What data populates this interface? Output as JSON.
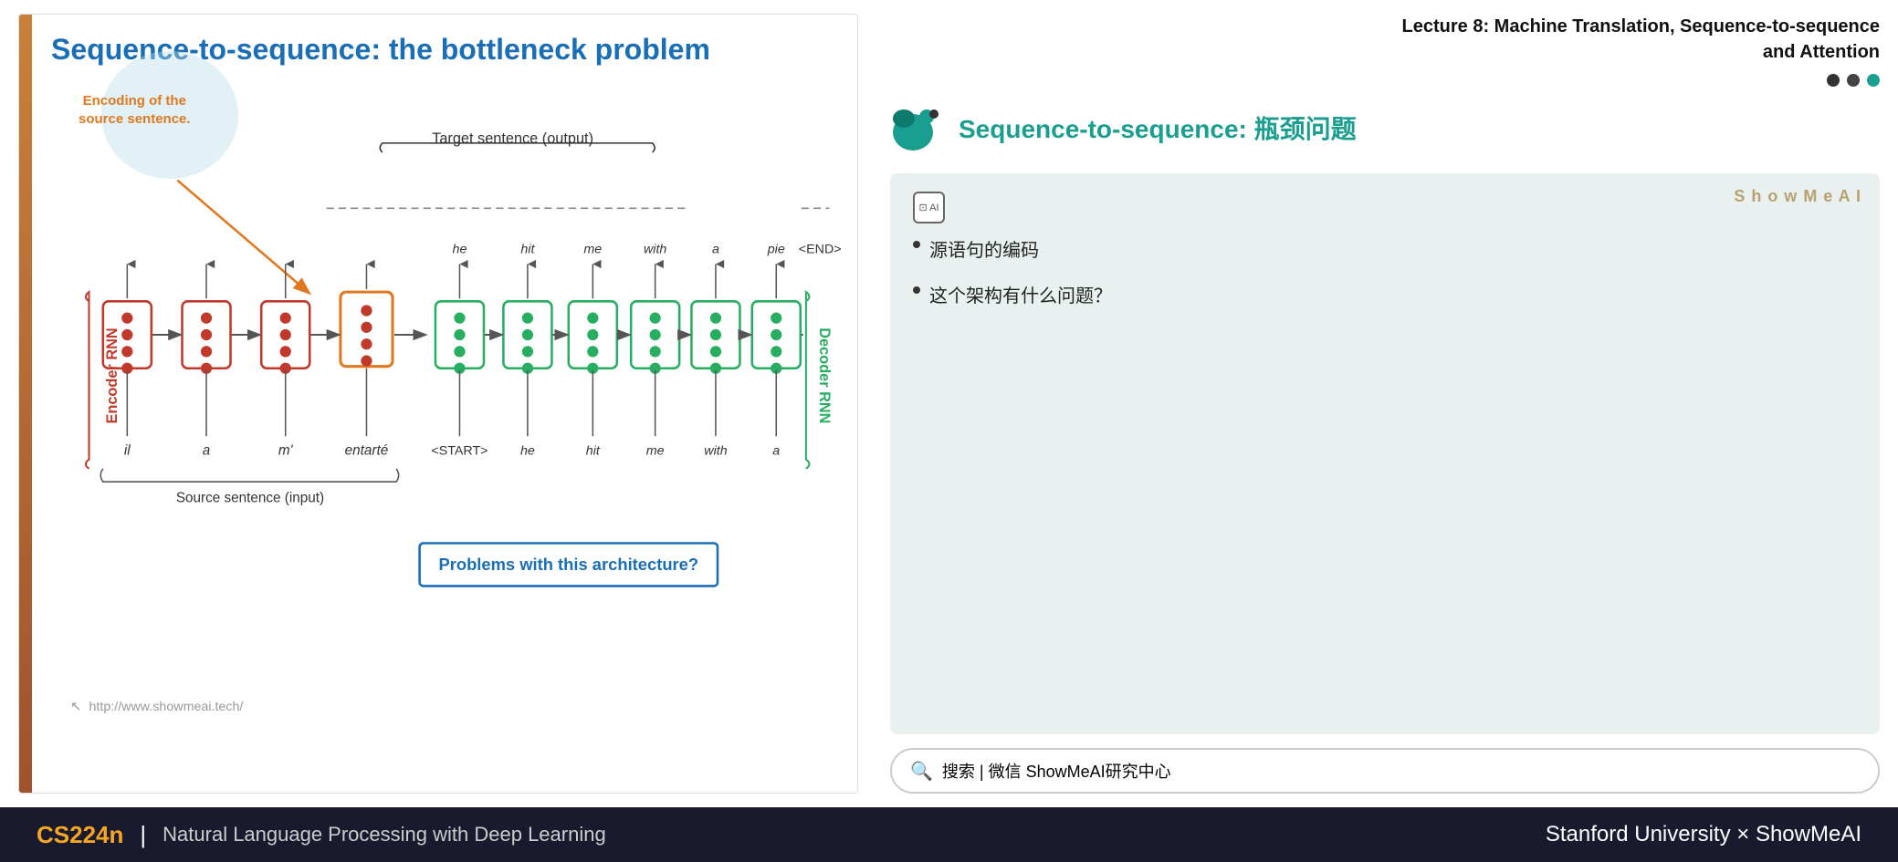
{
  "slide": {
    "title": "Sequence-to-sequence: the bottleneck problem",
    "encoding_label": "Encoding of the\nsource sentence.",
    "target_label": "Target sentence (output)",
    "source_label": "Source sentence (input)",
    "problems_text": "Problems with this architecture?",
    "url": "http://www.showmeai.tech/",
    "encoder_label": "Encoder RNN",
    "decoder_label": "Decoder RNN",
    "encoder_words": [
      "il",
      "a",
      "m'",
      "entarté"
    ],
    "decoder_words": [
      "he",
      "hit",
      "me",
      "with",
      "a",
      "pie"
    ],
    "start_word": "<START>",
    "output_words": [
      "he",
      "hit",
      "me",
      "with",
      "a",
      "pie",
      "<END>"
    ]
  },
  "right_panel": {
    "lecture_title": "Lecture 8:  Machine Translation, Sequence-to-sequence\nand Attention",
    "subtitle": "Sequence-to-sequence: 瓶颈问题",
    "showmeai_label": "S h o w M e A I",
    "bullets": [
      "源语句的编码",
      "这个架构有什么问题？"
    ],
    "search_text": "搜索 | 微信 ShowMeAI研究中心"
  },
  "bottom": {
    "cs_label": "CS224n",
    "divider": "|",
    "subtitle": "Natural Language Processing with Deep Learning",
    "right_text": "Stanford University × ShowMeAI"
  },
  "colors": {
    "accent_blue": "#1a6eb5",
    "accent_orange": "#e07820",
    "encoder_red": "#c0392b",
    "decoder_green": "#27ae60",
    "teal": "#1a9e8f",
    "bottom_bg": "#1a1a2e"
  }
}
